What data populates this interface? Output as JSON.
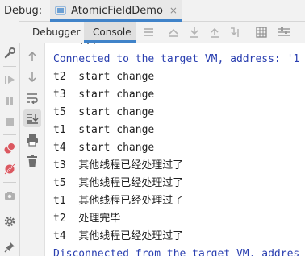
{
  "titlebar": {
    "label": "Debug:",
    "run_config_name": "AtomicFieldDemo",
    "close_glyph": "×"
  },
  "toolbar": {
    "tabs": [
      {
        "label": "Debugger",
        "active": false
      },
      {
        "label": "Console",
        "active": true
      }
    ],
    "icons": [
      "menu-icon",
      "restore-layout-icon",
      "step-over-icon",
      "step-into-icon",
      "step-out-icon",
      "run-to-cursor-icon",
      "evaluate-icon",
      "settings-icon"
    ]
  },
  "console": {
    "lines": [
      {
        "text": "    ...",
        "kind": "partial"
      },
      {
        "text": "Connected to the target VM, address: '1",
        "kind": "info"
      },
      {
        "text": "t2  start change",
        "kind": "out"
      },
      {
        "text": "t3  start change",
        "kind": "out"
      },
      {
        "text": "t5  start change",
        "kind": "out"
      },
      {
        "text": "t1  start change",
        "kind": "out"
      },
      {
        "text": "t4  start change",
        "kind": "out"
      },
      {
        "text": "t3  其他线程已经处理过了",
        "kind": "out"
      },
      {
        "text": "t5  其他线程已经处理过了",
        "kind": "out"
      },
      {
        "text": "t1  其他线程已经处理过了",
        "kind": "out"
      },
      {
        "text": "t2  处理完毕",
        "kind": "out"
      },
      {
        "text": "t4  其他线程已经处理过了",
        "kind": "out"
      },
      {
        "text": "Disconnected from the target VM, addres",
        "kind": "info"
      }
    ]
  },
  "colors": {
    "accent": "#4083c9",
    "info_text": "#2a3fb0",
    "resume_green": "#59a869",
    "stop_red": "#db5860"
  }
}
